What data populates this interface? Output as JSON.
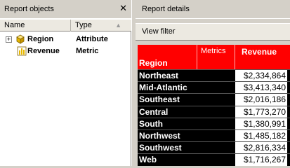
{
  "report_objects": {
    "title": "Report objects",
    "close_glyph": "✕",
    "columns": {
      "name": "Name",
      "type": "Type"
    },
    "sort_glyph": "▲",
    "items": [
      {
        "name": "Region",
        "type": "Attribute",
        "icon": "attribute-icon",
        "expander": "+"
      },
      {
        "name": "Revenue",
        "type": "Metric",
        "icon": "metric-icon"
      }
    ]
  },
  "report_details": {
    "title": "Report details",
    "view_filter_label": "View filter",
    "grid": {
      "region_header": "Region",
      "metrics_header": "Metrics",
      "revenue_header": "Revenue",
      "header_color": "#ff0000",
      "rows": [
        {
          "region": "Northeast",
          "revenue": "$2,334,864"
        },
        {
          "region": "Mid-Atlantic",
          "revenue": "$3,413,340"
        },
        {
          "region": "Southeast",
          "revenue": "$2,016,186"
        },
        {
          "region": "Central",
          "revenue": "$1,773,270"
        },
        {
          "region": "South",
          "revenue": "$1,380,991"
        },
        {
          "region": "Northwest",
          "revenue": "$1,485,182"
        },
        {
          "region": "Southwest",
          "revenue": "$2,816,334"
        },
        {
          "region": "Web",
          "revenue": "$1,716,267"
        }
      ]
    }
  }
}
